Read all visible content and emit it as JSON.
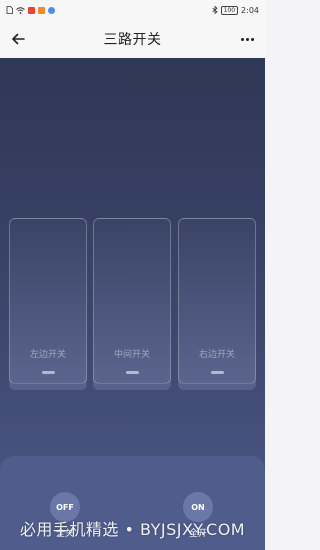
{
  "status_bar": {
    "battery": "100",
    "time": "2:04",
    "notification_colors": [
      "#e8443a",
      "#f28c28",
      "#4a8ff0"
    ],
    "icons": [
      "sim-icon",
      "wifi-icon",
      "notification-red-icon",
      "notification-orange-icon",
      "notification-blue-icon",
      "bluetooth-icon",
      "battery-icon"
    ]
  },
  "nav": {
    "title": "三路开关",
    "back_icon": "arrow-left-icon",
    "more_icon": "more-dots-icon"
  },
  "switches": [
    {
      "label": "左边开关"
    },
    {
      "label": "中间开关"
    },
    {
      "label": "右边开关"
    }
  ],
  "bottom": {
    "off_button": "OFF",
    "off_label": "全关",
    "on_button": "ON",
    "on_label": "全开"
  },
  "watermark": "必用手机精选 • BYJSJXY.COM",
  "colors": {
    "panel_top": "#2f3756",
    "panel_bottom": "#4c5889",
    "bottom_bar": "#505c8c",
    "button": "#6a77a7"
  }
}
